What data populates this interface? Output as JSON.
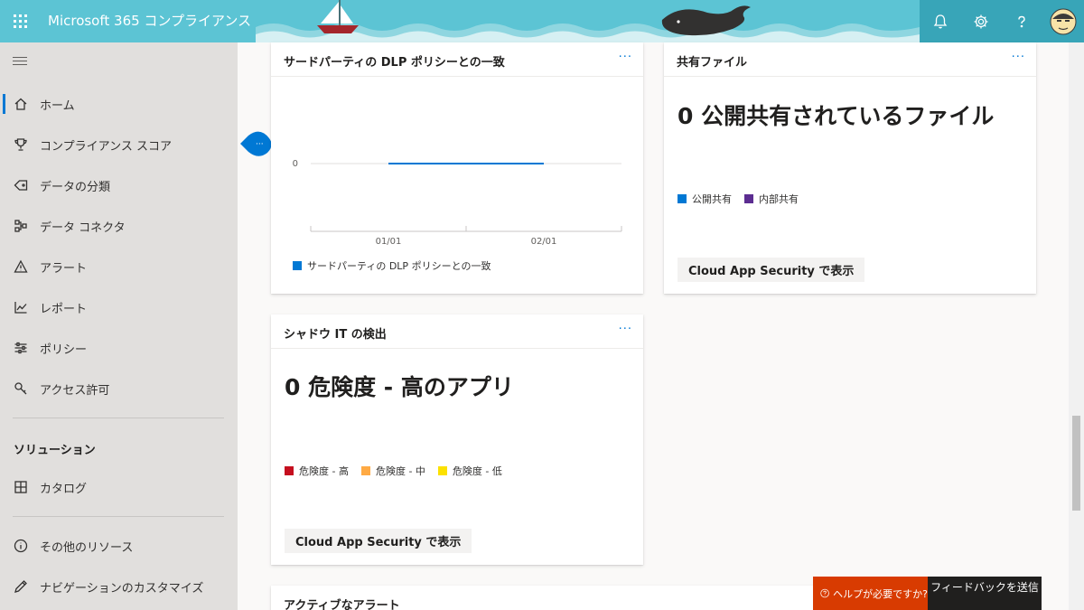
{
  "header": {
    "app_title": "Microsoft 365 コンプライアンス",
    "icons": [
      "waffle-icon",
      "bell-icon",
      "gear-icon",
      "help-icon",
      "avatar"
    ]
  },
  "sidebar": {
    "items": [
      {
        "label": "ホーム",
        "icon": "home-icon",
        "active": true
      },
      {
        "label": "コンプライアンス スコア",
        "icon": "trophy-icon"
      },
      {
        "label": "データの分類",
        "icon": "tag-icon"
      },
      {
        "label": "データ コネクタ",
        "icon": "connector-icon"
      },
      {
        "label": "アラート",
        "icon": "warning-icon"
      },
      {
        "label": "レポート",
        "icon": "chart-icon"
      },
      {
        "label": "ポリシー",
        "icon": "sliders-icon"
      },
      {
        "label": "アクセス許可",
        "icon": "key-icon"
      }
    ],
    "solutions_title": "ソリューション",
    "catalog_label": "カタログ",
    "other_resources_label": "その他のリソース",
    "customize_label": "ナビゲーションのカスタマイズ"
  },
  "cards": {
    "dlp": {
      "title": "サードパーティの DLP ポリシーとの一致",
      "more": "···",
      "legend": "サードパーティの DLP ポリシーとの一致"
    },
    "shared": {
      "title": "共有ファイル",
      "more": "···",
      "stat": "0 公開共有されているファイル",
      "legend": [
        "公開共有",
        "内部共有"
      ],
      "button": "Cloud App Security で表示"
    },
    "shadow": {
      "title": "シャドウ IT の検出",
      "more": "···",
      "stat": "0 危険度 - 高のアプリ",
      "legend": [
        "危険度 - 高",
        "危険度 - 中",
        "危険度 - 低"
      ],
      "button": "Cloud App Security で表示"
    },
    "alerts": {
      "title": "アクティブなアラート"
    }
  },
  "chart_data": {
    "type": "line",
    "x": [
      "01/01",
      "02/01"
    ],
    "series": [
      {
        "name": "サードパーティの DLP ポリシーとの一致",
        "color": "#0078d4",
        "values": [
          0,
          0
        ]
      }
    ],
    "ytick": "0"
  },
  "colors": {
    "accent": "#0078d4",
    "public_share": "#0078d4",
    "internal_share": "#5c2d91",
    "risk_high": "#c50f1f",
    "risk_medium": "#ffaa44",
    "risk_low": "#fce100",
    "help": "#d83b01"
  },
  "footer": {
    "help_label": "ヘルプが必要ですか?",
    "feedback_label": "フィードバックを送信"
  }
}
